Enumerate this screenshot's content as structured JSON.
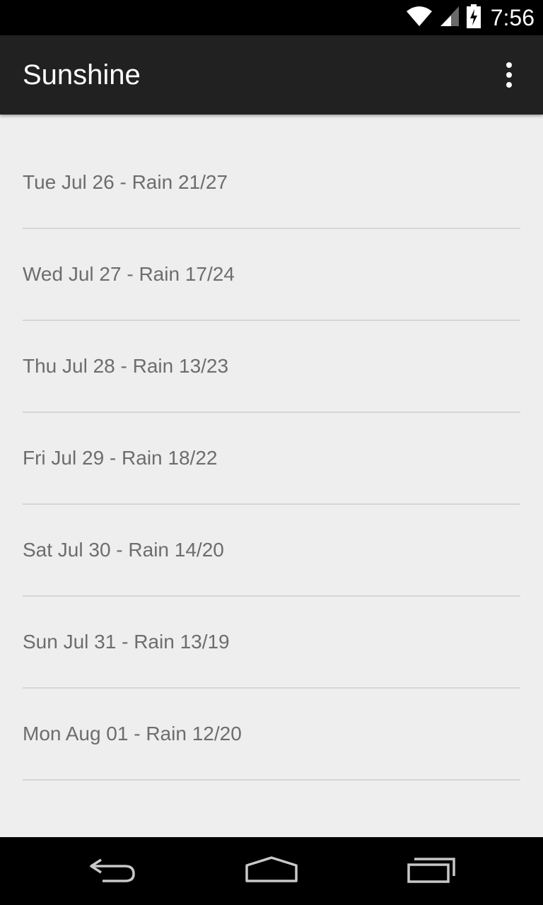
{
  "status_bar": {
    "time": "7:56",
    "icons": [
      "wifi-icon",
      "signal-icon",
      "battery-charging-icon"
    ]
  },
  "action_bar": {
    "title": "Sunshine",
    "overflow_icon": "more-vert-icon"
  },
  "forecast": {
    "items": [
      {
        "label": "Tue Jul 26 - Rain 21/27"
      },
      {
        "label": "Wed Jul 27 - Rain 17/24"
      },
      {
        "label": "Thu Jul 28 - Rain 13/23"
      },
      {
        "label": "Fri Jul 29 - Rain 18/22"
      },
      {
        "label": "Sat Jul 30 - Rain 14/20"
      },
      {
        "label": "Sun Jul 31 - Rain 13/19"
      },
      {
        "label": "Mon Aug 01 - Rain 12/20"
      }
    ]
  },
  "nav_bar": {
    "icons": [
      "back-icon",
      "home-icon",
      "recents-icon"
    ]
  },
  "colors": {
    "status_bar": "#000000",
    "action_bar": "#212121",
    "background": "#eeeeee",
    "list_text": "#6d6d6d",
    "divider": "#d6d6d6"
  }
}
